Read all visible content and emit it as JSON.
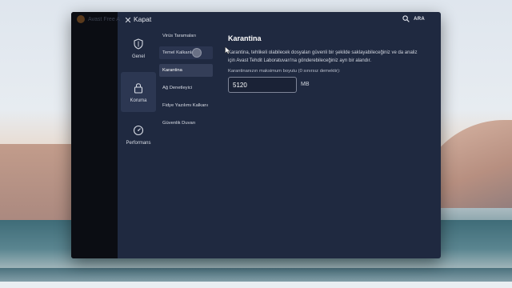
{
  "window": {
    "background_title": "Avast Free A",
    "close_label": "Kapat",
    "search_label": "ARA"
  },
  "categories": [
    {
      "label": "Genel",
      "icon": "shield-icon"
    },
    {
      "label": "Koruma",
      "icon": "lock-icon",
      "selected": true
    },
    {
      "label": "Performans",
      "icon": "speedometer-icon"
    }
  ],
  "submenu": [
    {
      "label": "Virüs Taramaları"
    },
    {
      "label": "Temel Kalkanlar"
    },
    {
      "label": "Karantina",
      "selected": true
    },
    {
      "label": "Ağ Denetleyici"
    },
    {
      "label": "Fidye Yazılımı Kalkanı"
    },
    {
      "label": "Güvenlik Duvarı"
    }
  ],
  "content": {
    "title": "Karantina",
    "description": "Karantina, tehlikeli olabilecek dosyaları güvenli bir şekilde saklayabileceğiniz ve da analiz için Avast Tehdit Laboratuvarı'na gönderebileceğiniz ayrı bir alandır.",
    "max_size_label": "Karantinanızın maksimum boyutu (0 sınırsız demektir):",
    "max_size_value": "5120",
    "unit": "MB"
  },
  "colors": {
    "window_bg": "#1f2940",
    "selected_bg": "#2c3752",
    "text": "#d8dce5"
  }
}
